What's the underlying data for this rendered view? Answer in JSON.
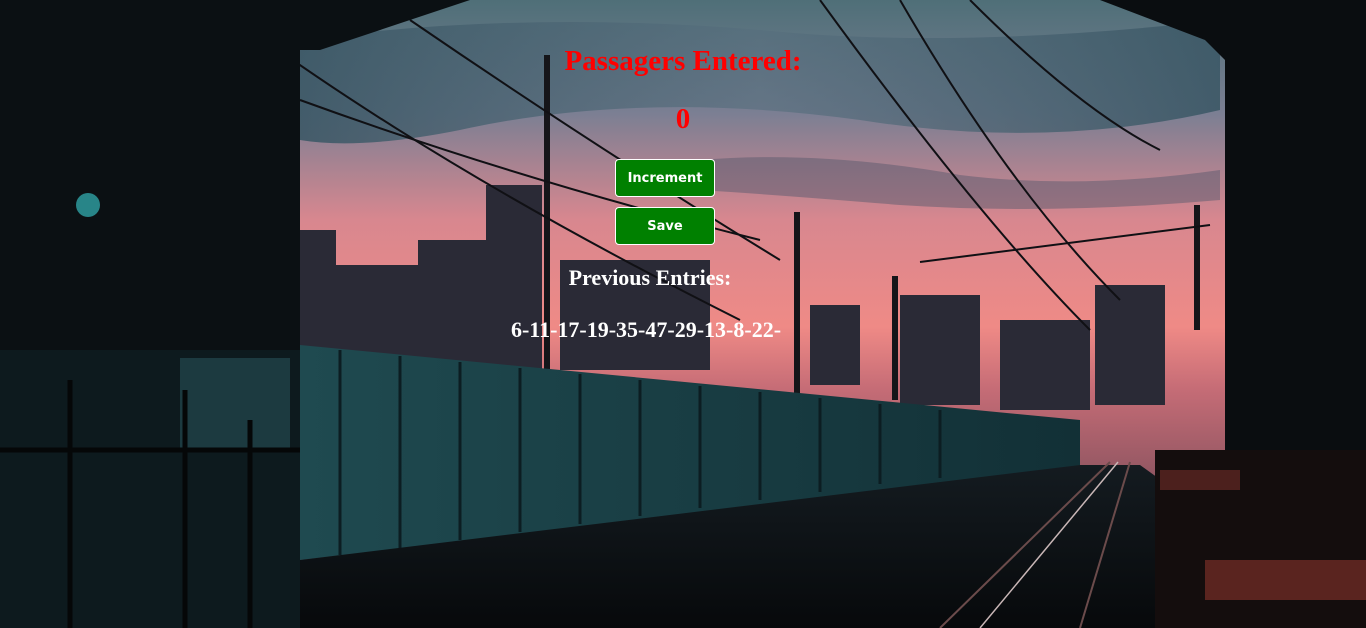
{
  "counter": {
    "title": "Passagers Entered:",
    "value": "0"
  },
  "buttons": {
    "increment_label": "Increment",
    "save_label": "Save"
  },
  "history": {
    "title": "Previous Entries:",
    "entries": "6-11-17-19-35-47-29-13-8-22-"
  },
  "colors": {
    "accent_red": "#ff0000",
    "button_green": "#008000",
    "text_white": "#ffffff"
  }
}
